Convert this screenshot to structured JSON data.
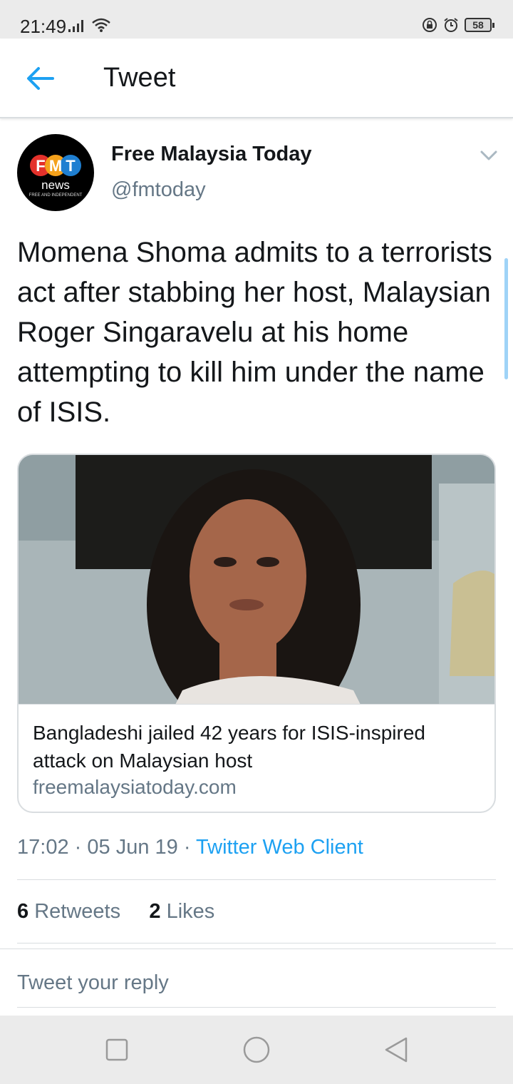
{
  "status_bar": {
    "time": "21:49",
    "battery": "58",
    "icons": [
      "signal-icon",
      "wifi-icon",
      "rotation-lock-icon",
      "alarm-icon",
      "battery-icon"
    ]
  },
  "app_bar": {
    "title": "Tweet",
    "back_icon": "arrow-left-icon",
    "accent_color": "#1da1f2"
  },
  "tweet": {
    "author_name": "Free Malaysia Today",
    "author_handle": "@fmtoday",
    "avatar": {
      "letters": [
        "F",
        "M",
        "T"
      ],
      "word": "news",
      "tagline": "FREE AND INDEPENDENT"
    },
    "text": "Momena Shoma admits to a terrorists act after stabbing her host, Malaysian Roger Singaravelu at his home attempting to kill him under the name of ISIS.",
    "card": {
      "title": "Bangladeshi jailed 42 years for ISIS-inspired attack on Malaysian host",
      "domain": "freemalaysiatoday.com"
    },
    "time": "17:02",
    "date": "05 Jun 19",
    "separator": "·",
    "client": "Twitter Web Client",
    "retweet_count": "6",
    "retweet_label": "Retweets",
    "like_count": "2",
    "like_label": "Likes",
    "reply_placeholder": "Tweet your reply"
  },
  "nav_bar": {
    "icons": [
      "recents-square-icon",
      "home-circle-icon",
      "back-triangle-icon"
    ]
  }
}
